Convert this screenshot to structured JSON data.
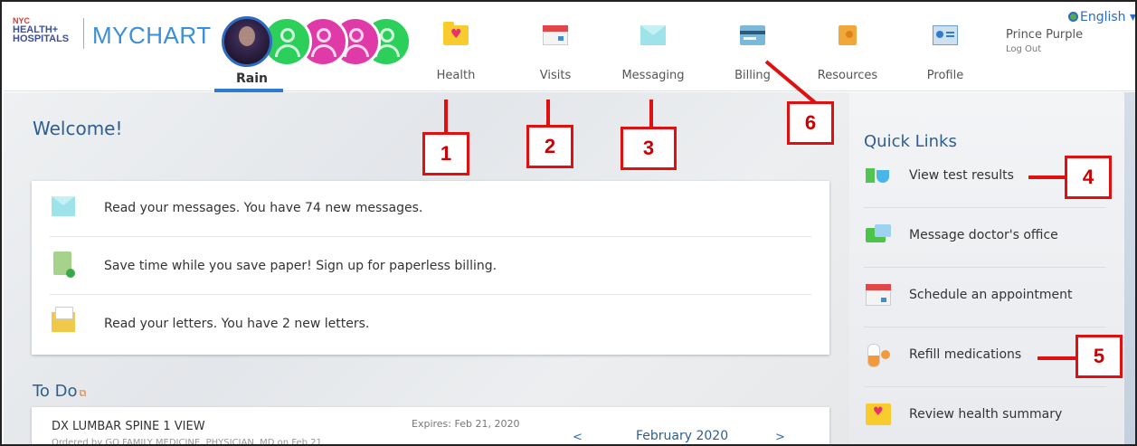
{
  "brand": {
    "nyc": "NYC",
    "line1": "HEALTH+",
    "line2": "HOSPITALS",
    "app": "MYCHART"
  },
  "proxy": {
    "active_name": "Rain"
  },
  "nav": [
    {
      "label": "Health",
      "icon": "health-folder-icon"
    },
    {
      "label": "Visits",
      "icon": "calendar-icon"
    },
    {
      "label": "Messaging",
      "icon": "envelope-icon"
    },
    {
      "label": "Billing",
      "icon": "credit-card-icon"
    },
    {
      "label": "Resources",
      "icon": "book-icon"
    },
    {
      "label": "Profile",
      "icon": "id-card-icon"
    }
  ],
  "account": {
    "language": "English",
    "user": "Prince Purple",
    "logout": "Log Out"
  },
  "welcome": "Welcome!",
  "messages": [
    {
      "text": "Read your messages. You have 74 new messages.",
      "icon": "envelope-icon"
    },
    {
      "text": "Save time while you save paper! Sign up for paperless billing.",
      "icon": "paperless-bill-icon"
    },
    {
      "text": "Read your letters. You have 2 new letters.",
      "icon": "letter-icon"
    }
  ],
  "todo": {
    "title": "To Do",
    "item_name": "DX LUMBAR SPINE 1 VIEW",
    "item_sub": "Ordered by GO FAMILY MEDICINE, PHYSICIAN, MD on Feb 21,",
    "expires": "Expires: Feb 21, 2020",
    "prev": "<",
    "month": "February 2020",
    "next": ">"
  },
  "quick_links": {
    "title": "Quick Links",
    "items": [
      {
        "label": "View test results",
        "icon": "test-tube-icon"
      },
      {
        "label": "Message doctor's office",
        "icon": "chat-bubble-icon"
      },
      {
        "label": "Schedule an appointment",
        "icon": "calendar-icon"
      },
      {
        "label": "Refill medications",
        "icon": "pill-icon"
      },
      {
        "label": "Review health summary",
        "icon": "health-folder-icon"
      }
    ]
  },
  "callouts": [
    "1",
    "2",
    "3",
    "4",
    "5",
    "6"
  ],
  "colors": {
    "brand_blue": "#2e6bc0",
    "heading_blue": "#2f5f8e",
    "callout_red": "#e01010"
  }
}
